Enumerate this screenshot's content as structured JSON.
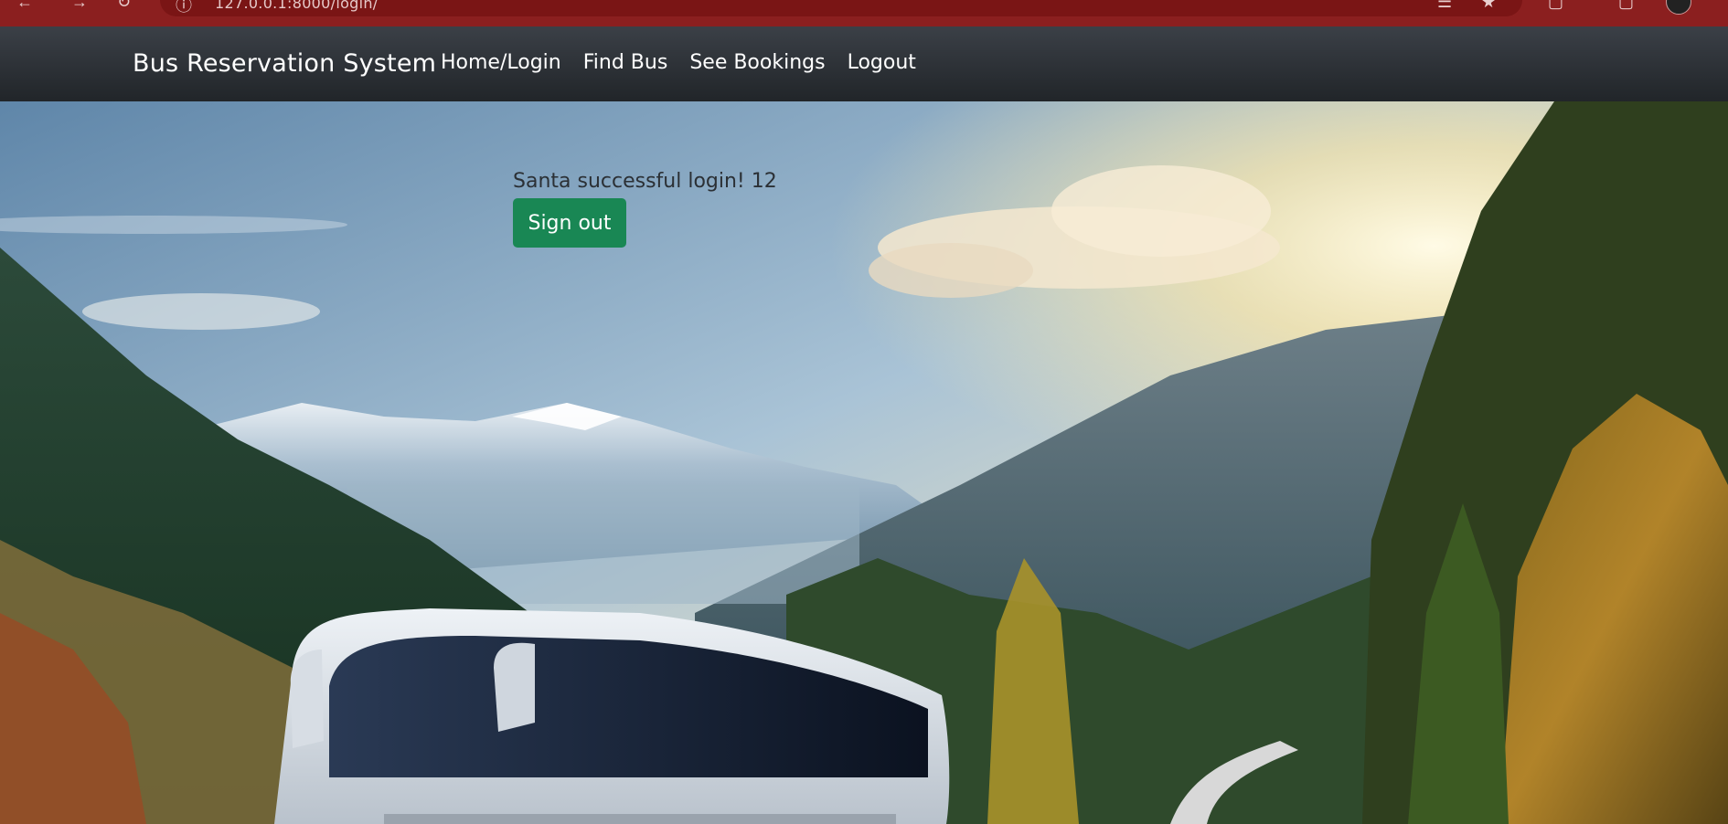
{
  "browser": {
    "url_text": "127.0.0.1:8000/login/",
    "icons": [
      "back-icon",
      "forward-icon",
      "reload-icon",
      "site-info-icon",
      "translate-icon",
      "bookmark-star-icon",
      "extensions-icon",
      "tab-search-icon",
      "profile-avatar"
    ]
  },
  "navbar": {
    "brand": "Bus Reservation System",
    "links": [
      {
        "label": "Home/Login"
      },
      {
        "label": "Find Bus"
      },
      {
        "label": "See Bookings"
      },
      {
        "label": "Logout"
      }
    ]
  },
  "main": {
    "message": "Santa successful login! 12",
    "signout_label": "Sign out"
  },
  "colors": {
    "navbar": "#212529",
    "button": "#198754",
    "browser_accent": "#8b1f1f"
  }
}
